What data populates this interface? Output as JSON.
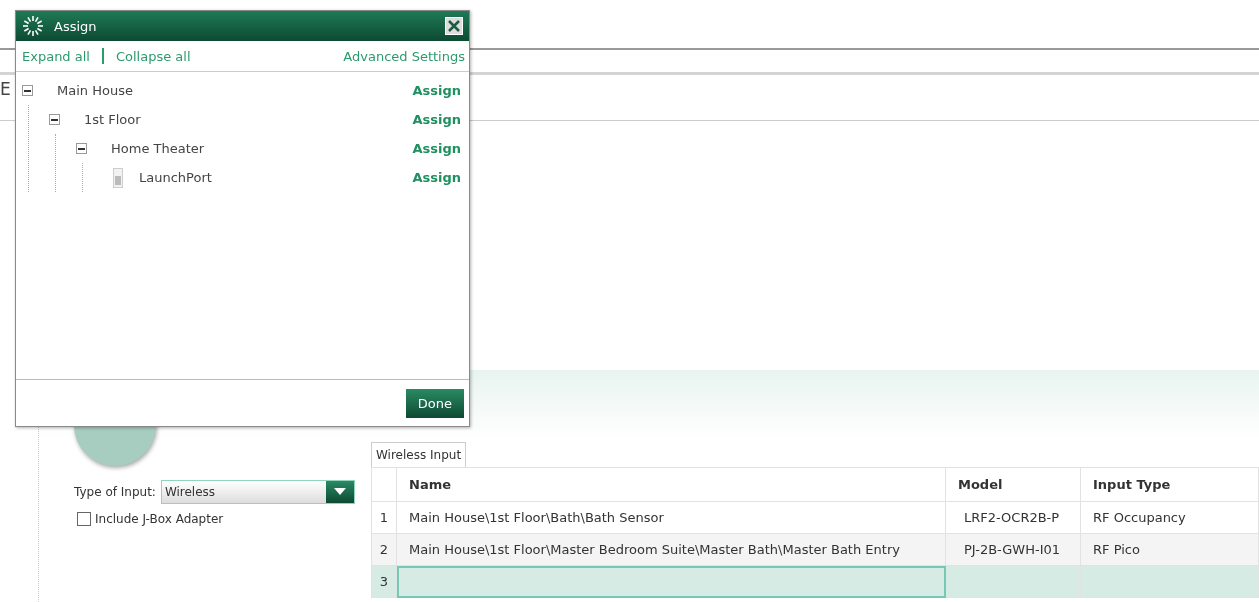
{
  "background_fragment": "E",
  "dialog": {
    "title": "Assign",
    "toolbar": {
      "expand_all": "Expand all",
      "collapse_all": "Collapse all",
      "advanced": "Advanced Settings"
    },
    "tree": [
      {
        "kind": "group",
        "label": "Main House",
        "expanded": true,
        "action": "Assign",
        "children": [
          {
            "kind": "group",
            "label": "1st Floor",
            "expanded": true,
            "action": "Assign",
            "children": [
              {
                "kind": "group",
                "label": "Home Theater",
                "expanded": true,
                "action": "Assign",
                "children": [
                  {
                    "kind": "device",
                    "label": "LaunchPort",
                    "action": "Assign"
                  }
                ]
              }
            ]
          }
        ]
      }
    ],
    "done_button": "Done"
  },
  "input_panel": {
    "type_label": "Type of Input:",
    "type_value": "Wireless",
    "jbox": {
      "label": "Include J-Box Adapter",
      "checked": false
    }
  },
  "tabs": [
    {
      "label": "Wireless Input",
      "selected": true
    }
  ],
  "table": {
    "columns": [
      "Name",
      "Model",
      "Input Type"
    ],
    "rows": [
      {
        "number": "1",
        "name": "Main House\\1st Floor\\Bath\\Bath Sensor",
        "model": "LRF2-OCR2B-P",
        "input_type": "RF Occupancy",
        "selected": false
      },
      {
        "number": "2",
        "name": "Main House\\1st Floor\\Master Bedroom Suite\\Master Bath\\Master Bath Entry",
        "model": "PJ-2B-GWH-I01",
        "input_type": "RF Pico",
        "selected": false
      },
      {
        "number": "3",
        "name": "",
        "model": "",
        "input_type": "",
        "selected": true
      }
    ]
  }
}
